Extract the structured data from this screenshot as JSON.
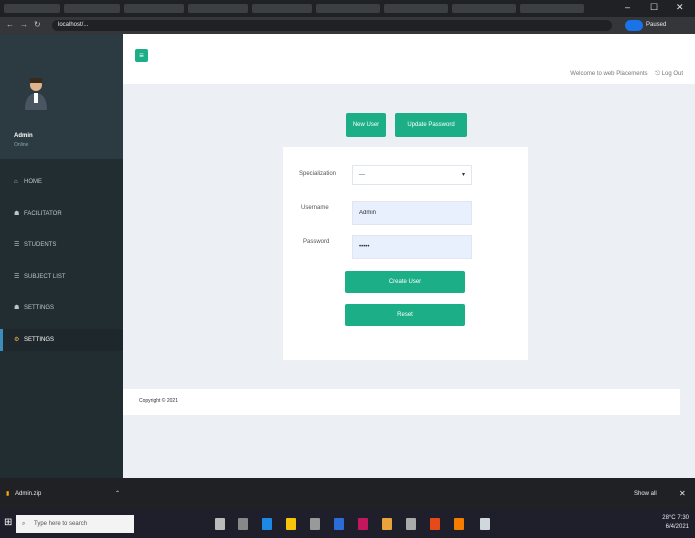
{
  "browser": {
    "url": "localhost/...",
    "window_controls": [
      "–",
      "☐",
      "✕"
    ],
    "nav_icons": [
      "←",
      "→",
      "↻"
    ],
    "profile_label": "Paused"
  },
  "colors": {
    "accent": "#1cae87",
    "sidebar_bg": "#222d32",
    "content_bg": "#ecf0f5",
    "active_border": "#3c8dbc"
  },
  "sidebar": {
    "user_name": "Admin",
    "user_status": "Online",
    "items": [
      {
        "icon": "home-icon",
        "glyph": "⌂",
        "label": "HOME"
      },
      {
        "icon": "users-icon",
        "glyph": "☗",
        "label": "FACILITATOR"
      },
      {
        "icon": "list-icon",
        "glyph": "☰",
        "label": "STUDENTS"
      },
      {
        "icon": "list-icon",
        "glyph": "☰",
        "label": "SUBJECT LIST"
      },
      {
        "icon": "user-icon",
        "glyph": "☗",
        "label": "SETTINGS"
      },
      {
        "icon": "gear-icon",
        "glyph": "⚙",
        "label": "SETTINGS"
      }
    ],
    "active_index": 5
  },
  "header": {
    "toggle_glyph": "≡",
    "welcome": "Welcome to web Placements",
    "logout": "Log Out"
  },
  "actions": {
    "new_user": "New User",
    "update_password": "Update Password"
  },
  "form": {
    "specialization_label": "Specialization",
    "specialization_value": "---",
    "username_label": "Username",
    "username_value": "Admin",
    "password_label": "Password",
    "password_value": "•••••",
    "create_button": "Create User",
    "reset_button": "Reset"
  },
  "footer": {
    "copyright": "Copyright © 2021"
  },
  "downloads": {
    "file_name": "Admin.zip",
    "show_all": "Show all"
  },
  "taskbar": {
    "search_placeholder": "Type here to search",
    "temperature": "28°C",
    "time": "7:30",
    "date": "6/4/2021"
  }
}
